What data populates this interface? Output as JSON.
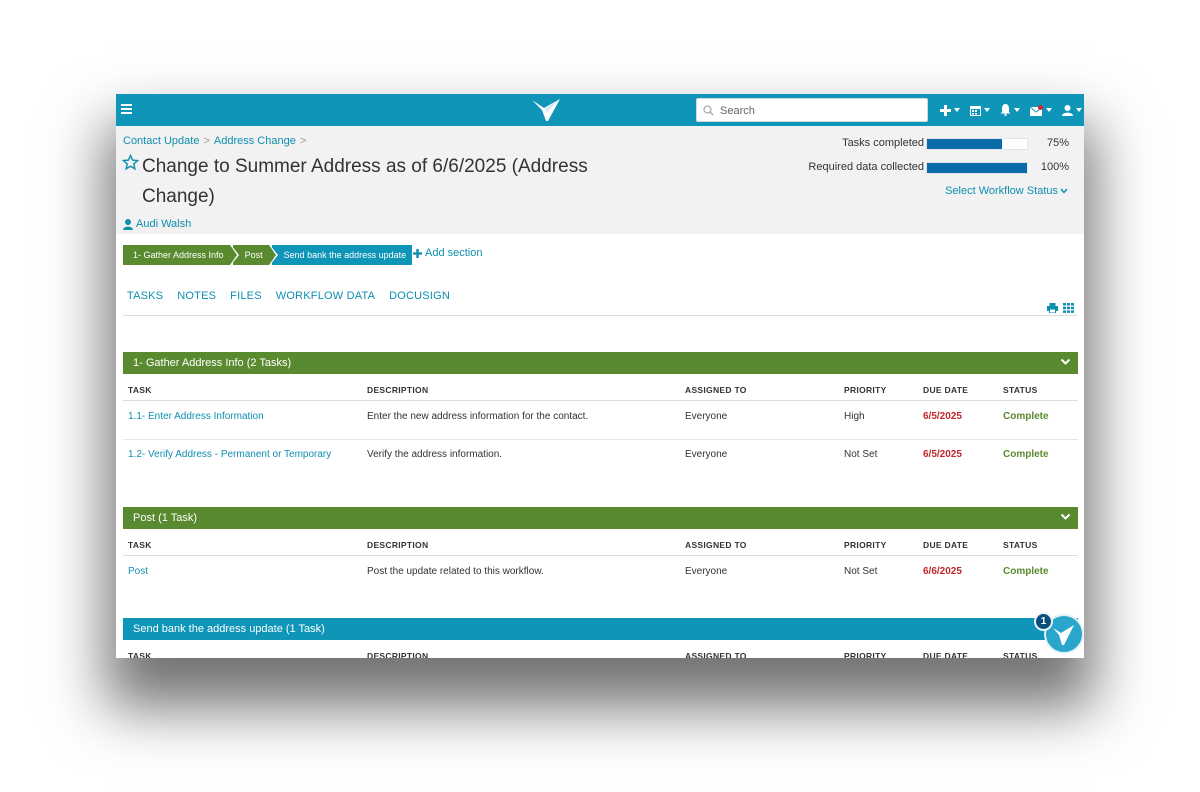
{
  "topbar": {
    "search_placeholder": "Search",
    "icons": [
      "menu-icon",
      "logo-icon",
      "search-icon",
      "plus-icon",
      "calendar-icon",
      "bell-icon",
      "mail-icon",
      "user-icon"
    ]
  },
  "breadcrumb": [
    "Contact Update",
    "Address Change"
  ],
  "title": "Change to Summer Address as of 6/6/2025 (Address Change)",
  "owner": "Audi Walsh",
  "metrics": [
    {
      "label": "Tasks completed",
      "percent_label": "75%",
      "fraction": 0.75
    },
    {
      "label": "Required data collected",
      "percent_label": "100%",
      "fraction": 1.0
    }
  ],
  "workflow_status_label": "Select Workflow Status",
  "sections_bar": [
    "1- Gather Address Info",
    "Post",
    "Send bank the address update"
  ],
  "add_section_label": "Add section",
  "tabs": [
    "TASKS",
    "NOTES",
    "FILES",
    "WORKFLOW DATA",
    "DOCUSIGN"
  ],
  "columns": [
    "TASK",
    "DESCRIPTION",
    "ASSIGNED TO",
    "PRIORITY",
    "DUE DATE",
    "STATUS"
  ],
  "groups": [
    {
      "title": "1- Gather Address Info (2 Tasks)",
      "color": "#5a8a2f",
      "rows": [
        {
          "task": "1.1- Enter Address Information",
          "description": "Enter the new address information for the contact.",
          "assigned": "Everyone",
          "priority": "High",
          "due": "6/5/2025",
          "status": "Complete"
        },
        {
          "task": "1.2- Verify Address - Permanent or Temporary",
          "description": "Verify the address information.",
          "assigned": "Everyone",
          "priority": "Not Set",
          "due": "6/5/2025",
          "status": "Complete"
        }
      ]
    },
    {
      "title": "Post (1 Task)",
      "color": "#5a8a2f",
      "rows": [
        {
          "task": "Post",
          "description": "Post the update related to this workflow.",
          "assigned": "Everyone",
          "priority": "Not Set",
          "due": "6/6/2025",
          "status": "Complete"
        }
      ]
    },
    {
      "title": "Send bank the address update (1 Task)",
      "color": "#0e95b8",
      "rows": []
    }
  ],
  "notification_badge": "1",
  "colors": {
    "brand": "#0e95b8",
    "section_green": "#5a8a2f",
    "link": "#0e8fb0",
    "due_red": "#c0262d",
    "progress": "#0b6aa8"
  }
}
